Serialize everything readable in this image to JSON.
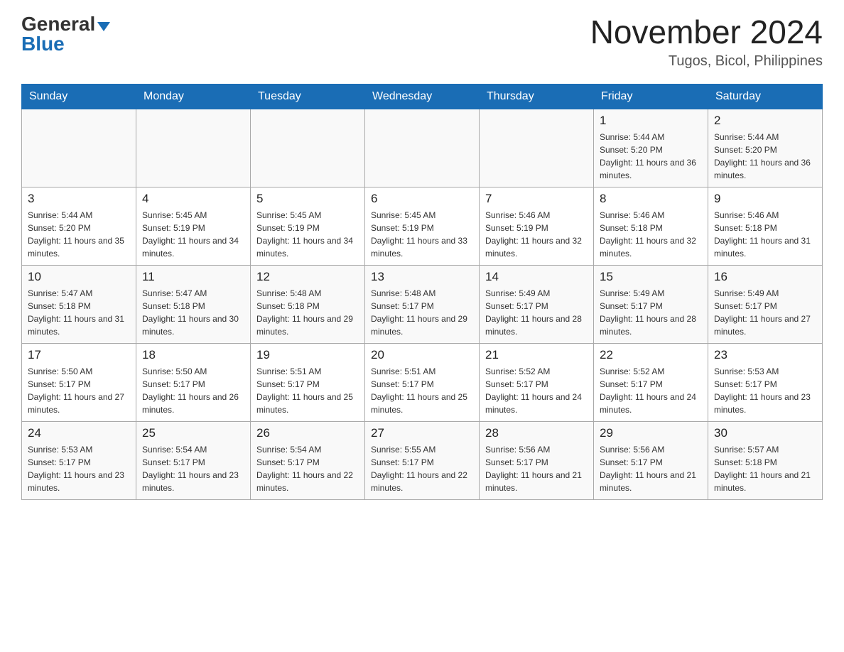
{
  "header": {
    "logo_general": "General",
    "logo_blue": "Blue",
    "title": "November 2024",
    "subtitle": "Tugos, Bicol, Philippines"
  },
  "days_of_week": [
    "Sunday",
    "Monday",
    "Tuesday",
    "Wednesday",
    "Thursday",
    "Friday",
    "Saturday"
  ],
  "weeks": [
    [
      {
        "day": "",
        "info": ""
      },
      {
        "day": "",
        "info": ""
      },
      {
        "day": "",
        "info": ""
      },
      {
        "day": "",
        "info": ""
      },
      {
        "day": "",
        "info": ""
      },
      {
        "day": "1",
        "info": "Sunrise: 5:44 AM\nSunset: 5:20 PM\nDaylight: 11 hours and 36 minutes."
      },
      {
        "day": "2",
        "info": "Sunrise: 5:44 AM\nSunset: 5:20 PM\nDaylight: 11 hours and 36 minutes."
      }
    ],
    [
      {
        "day": "3",
        "info": "Sunrise: 5:44 AM\nSunset: 5:20 PM\nDaylight: 11 hours and 35 minutes."
      },
      {
        "day": "4",
        "info": "Sunrise: 5:45 AM\nSunset: 5:19 PM\nDaylight: 11 hours and 34 minutes."
      },
      {
        "day": "5",
        "info": "Sunrise: 5:45 AM\nSunset: 5:19 PM\nDaylight: 11 hours and 34 minutes."
      },
      {
        "day": "6",
        "info": "Sunrise: 5:45 AM\nSunset: 5:19 PM\nDaylight: 11 hours and 33 minutes."
      },
      {
        "day": "7",
        "info": "Sunrise: 5:46 AM\nSunset: 5:19 PM\nDaylight: 11 hours and 32 minutes."
      },
      {
        "day": "8",
        "info": "Sunrise: 5:46 AM\nSunset: 5:18 PM\nDaylight: 11 hours and 32 minutes."
      },
      {
        "day": "9",
        "info": "Sunrise: 5:46 AM\nSunset: 5:18 PM\nDaylight: 11 hours and 31 minutes."
      }
    ],
    [
      {
        "day": "10",
        "info": "Sunrise: 5:47 AM\nSunset: 5:18 PM\nDaylight: 11 hours and 31 minutes."
      },
      {
        "day": "11",
        "info": "Sunrise: 5:47 AM\nSunset: 5:18 PM\nDaylight: 11 hours and 30 minutes."
      },
      {
        "day": "12",
        "info": "Sunrise: 5:48 AM\nSunset: 5:18 PM\nDaylight: 11 hours and 29 minutes."
      },
      {
        "day": "13",
        "info": "Sunrise: 5:48 AM\nSunset: 5:17 PM\nDaylight: 11 hours and 29 minutes."
      },
      {
        "day": "14",
        "info": "Sunrise: 5:49 AM\nSunset: 5:17 PM\nDaylight: 11 hours and 28 minutes."
      },
      {
        "day": "15",
        "info": "Sunrise: 5:49 AM\nSunset: 5:17 PM\nDaylight: 11 hours and 28 minutes."
      },
      {
        "day": "16",
        "info": "Sunrise: 5:49 AM\nSunset: 5:17 PM\nDaylight: 11 hours and 27 minutes."
      }
    ],
    [
      {
        "day": "17",
        "info": "Sunrise: 5:50 AM\nSunset: 5:17 PM\nDaylight: 11 hours and 27 minutes."
      },
      {
        "day": "18",
        "info": "Sunrise: 5:50 AM\nSunset: 5:17 PM\nDaylight: 11 hours and 26 minutes."
      },
      {
        "day": "19",
        "info": "Sunrise: 5:51 AM\nSunset: 5:17 PM\nDaylight: 11 hours and 25 minutes."
      },
      {
        "day": "20",
        "info": "Sunrise: 5:51 AM\nSunset: 5:17 PM\nDaylight: 11 hours and 25 minutes."
      },
      {
        "day": "21",
        "info": "Sunrise: 5:52 AM\nSunset: 5:17 PM\nDaylight: 11 hours and 24 minutes."
      },
      {
        "day": "22",
        "info": "Sunrise: 5:52 AM\nSunset: 5:17 PM\nDaylight: 11 hours and 24 minutes."
      },
      {
        "day": "23",
        "info": "Sunrise: 5:53 AM\nSunset: 5:17 PM\nDaylight: 11 hours and 23 minutes."
      }
    ],
    [
      {
        "day": "24",
        "info": "Sunrise: 5:53 AM\nSunset: 5:17 PM\nDaylight: 11 hours and 23 minutes."
      },
      {
        "day": "25",
        "info": "Sunrise: 5:54 AM\nSunset: 5:17 PM\nDaylight: 11 hours and 23 minutes."
      },
      {
        "day": "26",
        "info": "Sunrise: 5:54 AM\nSunset: 5:17 PM\nDaylight: 11 hours and 22 minutes."
      },
      {
        "day": "27",
        "info": "Sunrise: 5:55 AM\nSunset: 5:17 PM\nDaylight: 11 hours and 22 minutes."
      },
      {
        "day": "28",
        "info": "Sunrise: 5:56 AM\nSunset: 5:17 PM\nDaylight: 11 hours and 21 minutes."
      },
      {
        "day": "29",
        "info": "Sunrise: 5:56 AM\nSunset: 5:17 PM\nDaylight: 11 hours and 21 minutes."
      },
      {
        "day": "30",
        "info": "Sunrise: 5:57 AM\nSunset: 5:18 PM\nDaylight: 11 hours and 21 minutes."
      }
    ]
  ]
}
